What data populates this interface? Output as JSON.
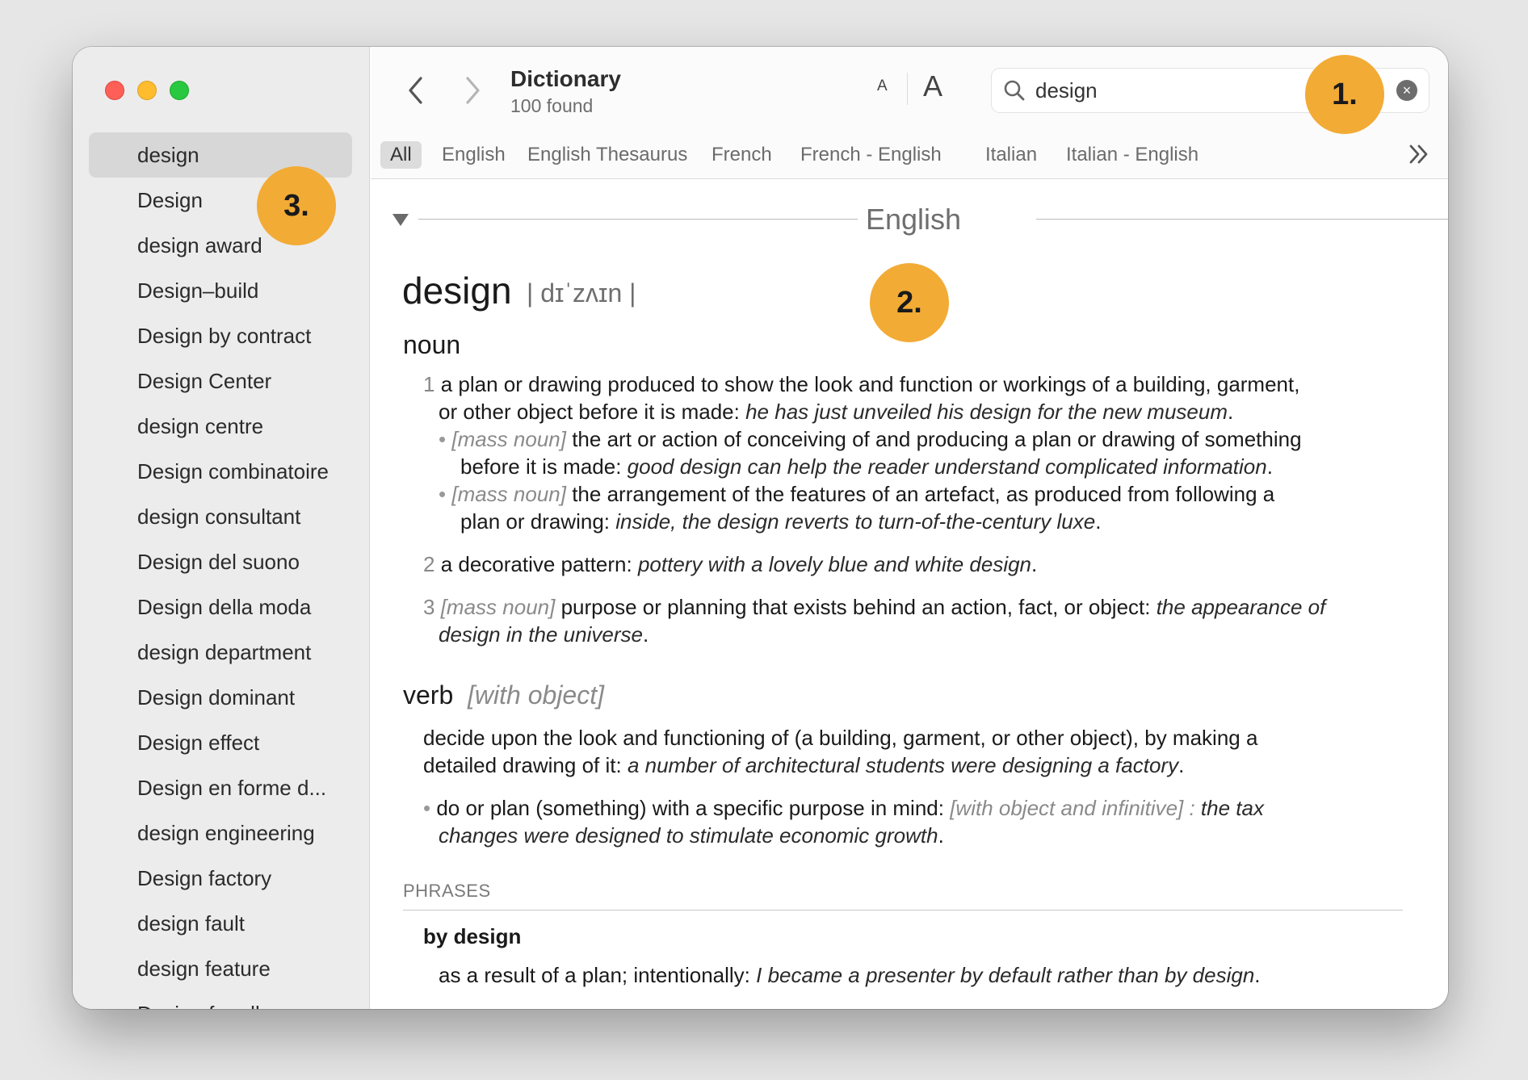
{
  "window": {
    "title": "Dictionary",
    "found": "100 found"
  },
  "font_controls": {
    "small": "A",
    "large": "A"
  },
  "search": {
    "value": "design",
    "clear_icon": "xmark-circle-icon"
  },
  "tabs": [
    "All",
    "English",
    "English Thesaurus",
    "French",
    "French - English",
    "Italian",
    "Italian - English"
  ],
  "sidebar": {
    "items": [
      "design",
      "Design",
      "design award",
      "Design–build",
      "Design by contract",
      "Design Center",
      "design centre",
      "Design combinatoire",
      "design consultant",
      "Design del suono",
      "Design della moda",
      "design department",
      "Design dominant",
      "Design effect",
      "Design en forme d...",
      "design engineering",
      "Design factory",
      "design fault",
      "design feature",
      "Design for all"
    ]
  },
  "entry": {
    "section": "English",
    "headword": "design",
    "pronunciation": "| dɪˈzʌɪn |",
    "noun": {
      "label": "noun",
      "sense1": {
        "num": "1",
        "l1": "a plan or drawing produced to show the look and function or workings of a building, garment,",
        "l2a": "or other object before it is made: ",
        "l2b": "he has just unveiled his design for the new museum",
        "l2c": ".",
        "sub1": {
          "bullet": "•",
          "gram": "[mass noun]",
          "l1": " the art or action of conceiving of and producing a plan or drawing of something",
          "l2a": "before it is made: ",
          "l2b": "good design can help the reader understand complicated information",
          "l2c": "."
        },
        "sub2": {
          "bullet": "•",
          "gram": "[mass noun]",
          "l1": " the arrangement of the features of an artefact, as produced from following a",
          "l2a": "plan or drawing: ",
          "l2b": "inside, the design reverts to turn-of-the-century luxe",
          "l2c": "."
        }
      },
      "sense2": {
        "num": "2",
        "a": " a decorative pattern: ",
        "b": "pottery with a lovely blue and white design",
        "c": "."
      },
      "sense3": {
        "num": "3",
        "gram": "[mass noun]",
        "a": " purpose or planning that exists behind an action, fact, or object: ",
        "b": "the appearance of",
        "l2": "design in the universe",
        "l2c": "."
      }
    },
    "verb": {
      "label": "verb",
      "gram": "[with object]",
      "def1_l1": "decide upon the look and functioning of (a building, garment, or other object), by making a",
      "def1_l2a": "detailed drawing of it: ",
      "def1_l2b": "a number of architectural students were designing a factory",
      "def1_l2c": ".",
      "sub": {
        "bullet": "•",
        "a": " do or plan (something) with a specific purpose in mind: ",
        "gram": "[with object and infinitive] : ",
        "b": "the tax",
        "l2": "changes were designed to stimulate economic growth",
        "l2c": "."
      }
    },
    "phrases": {
      "label": "PHRASES",
      "head": "by design",
      "def_a": "as a result of a plan; intentionally: ",
      "def_b": "I became a presenter by default rather than by design",
      "def_c": "."
    }
  },
  "callouts": [
    "1.",
    "2.",
    "3."
  ]
}
